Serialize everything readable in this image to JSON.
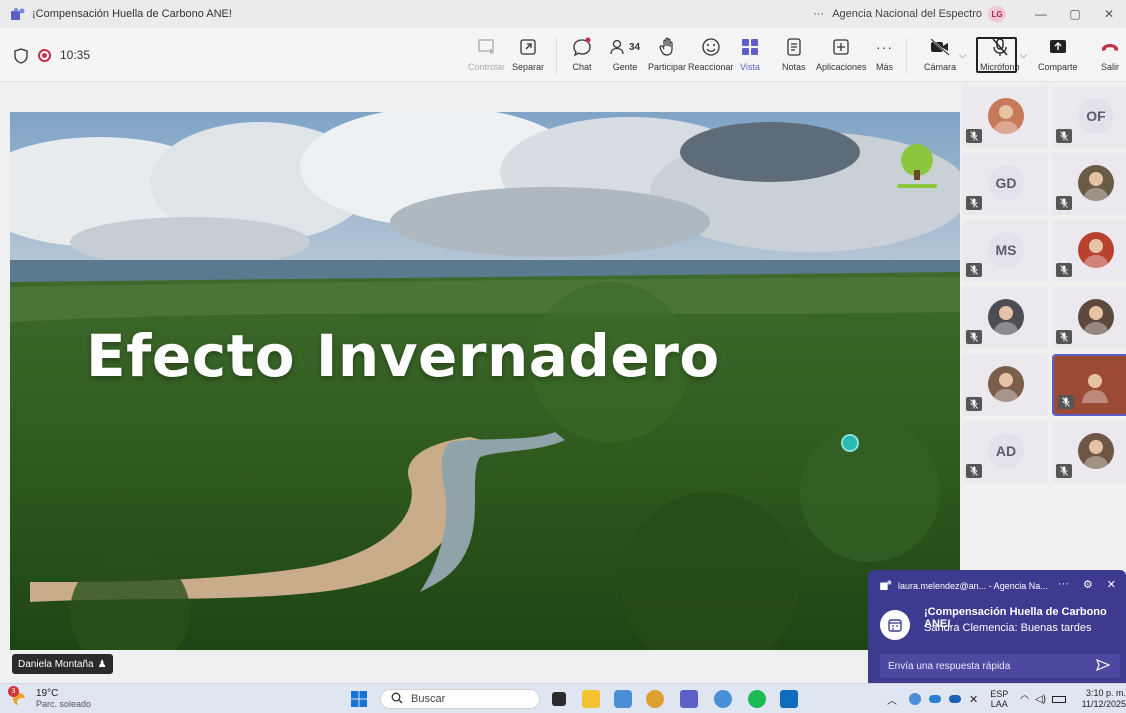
{
  "window": {
    "title": "¡Compensación Huella de Carbono ANE!",
    "org": "Agencia Nacional del Espectro",
    "user_initials": "LG",
    "more": "···",
    "minimize": "—",
    "restore": "▢",
    "close": "✕"
  },
  "meeting": {
    "time": "10:35",
    "people_count": "34"
  },
  "toolbar": {
    "controlar": "Controlar",
    "separar": "Separar",
    "chat": "Chat",
    "gente": "Gente",
    "participar": "Participar",
    "reaccionar": "Reaccionar",
    "vista": "Vista",
    "notas": "Notas",
    "aplicaciones": "Aplicaciones",
    "mas": "Más",
    "camara": "Cámara",
    "microfono": "Micrófono",
    "comparte": "Comparte",
    "salir": "Salir"
  },
  "slide": {
    "title": "Efecto Invernadero"
  },
  "presenter": {
    "name": "Daniela Montaña"
  },
  "participants": [
    {
      "initials": "",
      "kind": "photo",
      "color": "#c77a5a"
    },
    {
      "initials": "OF",
      "kind": "initials"
    },
    {
      "initials": "GD",
      "kind": "initials"
    },
    {
      "initials": "",
      "kind": "photo",
      "color": "#6a5a48"
    },
    {
      "initials": "MS",
      "kind": "initials"
    },
    {
      "initials": "",
      "kind": "photo",
      "color": "#b8412f"
    },
    {
      "initials": "",
      "kind": "photo",
      "color": "#4d4d55"
    },
    {
      "initials": "",
      "kind": "photo",
      "color": "#5c4a3e"
    },
    {
      "initials": "",
      "kind": "photo",
      "color": "#7a5d4a"
    },
    {
      "initials": "",
      "kind": "photo",
      "color": "#9b4a36"
    },
    {
      "initials": "AD",
      "kind": "initials"
    },
    {
      "initials": "",
      "kind": "photo",
      "color": "#6e5646"
    },
    {
      "initials": "LG",
      "kind": "initials"
    }
  ],
  "notification": {
    "sender": "laura.melendez@an... - Agencia Na...",
    "title": "¡Compensación Huella de Carbono ANE!",
    "message": "Sandra Clemencia: Buenas tardes",
    "reply_placeholder": "Envía una respuesta rápida"
  },
  "taskbar": {
    "weather_temp": "19°C",
    "weather_cond": "Parc. soleado",
    "weather_badge": "3",
    "search": "Buscar",
    "lang1": "ESP",
    "lang2": "LAA",
    "time": "3:10 p. m.",
    "date": "11/12/2025"
  },
  "colors": {
    "accent": "#5b5fc7",
    "leave": "#c4314b",
    "notification_bg": "#3d3b8f"
  }
}
